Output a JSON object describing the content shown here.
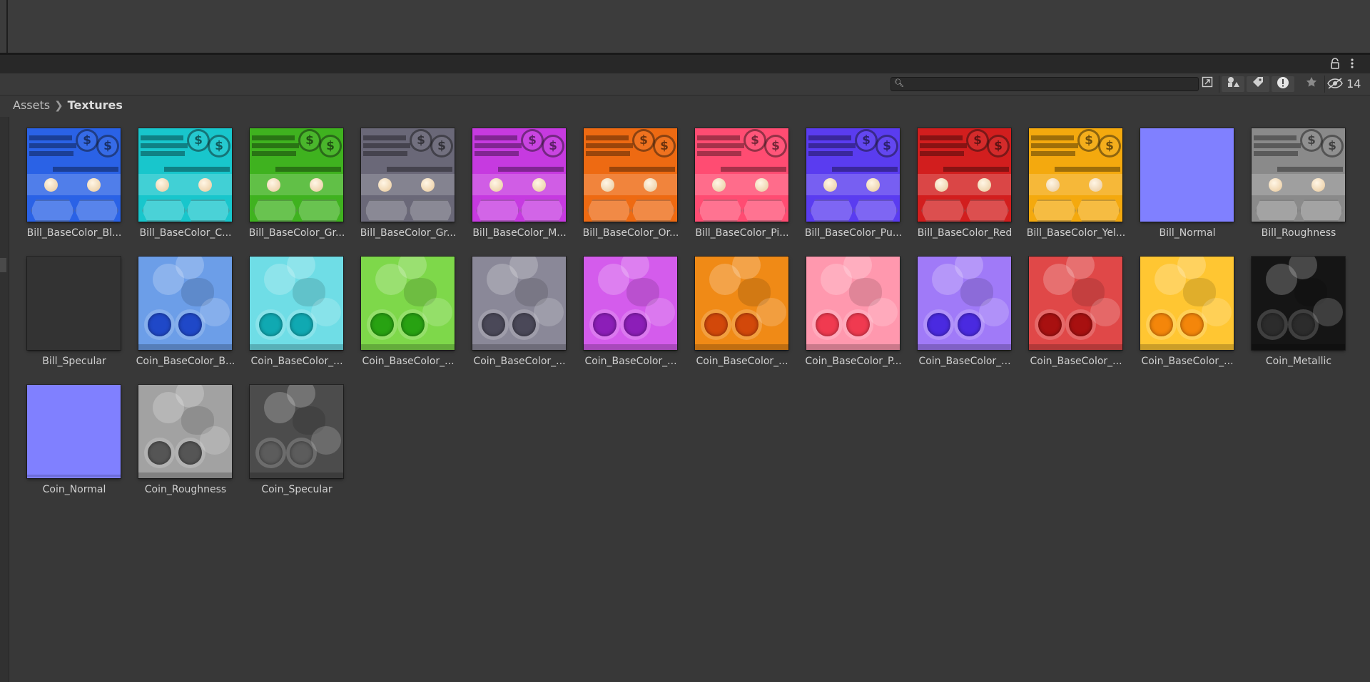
{
  "toolbar": {
    "search_placeholder": "",
    "hidden_count": "14",
    "icons": [
      "lock-icon",
      "kebab-menu-icon",
      "search-icon",
      "maximize-icon",
      "type-filter-icon",
      "label-filter-icon",
      "warning-filter-icon",
      "favorite-star-icon",
      "hidden-eye-icon"
    ]
  },
  "breadcrumb": {
    "root": "Assets",
    "current": "Textures"
  },
  "assets": [
    {
      "label": "Bill_BaseColor_Bl...",
      "kind": "bill",
      "color": "#2a62e6"
    },
    {
      "label": "Bill_BaseColor_C...",
      "kind": "bill",
      "color": "#18c6cc"
    },
    {
      "label": "Bill_BaseColor_Gr...",
      "kind": "bill",
      "color": "#3fb21f"
    },
    {
      "label": "Bill_BaseColor_Gr...",
      "kind": "bill",
      "color": "#6a6878"
    },
    {
      "label": "Bill_BaseColor_M...",
      "kind": "bill",
      "color": "#c63ae0"
    },
    {
      "label": "Bill_BaseColor_Or...",
      "kind": "bill",
      "color": "#ee6a12"
    },
    {
      "label": "Bill_BaseColor_Pi...",
      "kind": "bill",
      "color": "#ff4c72"
    },
    {
      "label": "Bill_BaseColor_Pu...",
      "kind": "bill",
      "color": "#5a3cf0"
    },
    {
      "label": "Bill_BaseColor_Red",
      "kind": "bill",
      "color": "#d21e1e"
    },
    {
      "label": "Bill_BaseColor_Yel...",
      "kind": "bill",
      "color": "#f4a90e"
    },
    {
      "label": "Bill_Normal",
      "kind": "flat",
      "color": "#8080ff"
    },
    {
      "label": "Bill_Roughness",
      "kind": "bill",
      "color": "#8a8a8a"
    },
    {
      "label": "Bill_Specular",
      "kind": "flat",
      "color": "#333333"
    },
    {
      "label": "Coin_BaseColor_B...",
      "kind": "coin",
      "color": "#6c9ee8",
      "disc": "#1f48c8"
    },
    {
      "label": "Coin_BaseColor_...",
      "kind": "coin",
      "color": "#6fdde6",
      "disc": "#10a9b2"
    },
    {
      "label": "Coin_BaseColor_...",
      "kind": "coin",
      "color": "#7ed84a",
      "disc": "#28a212"
    },
    {
      "label": "Coin_BaseColor_...",
      "kind": "coin",
      "color": "#8a8898",
      "disc": "#4a4858"
    },
    {
      "label": "Coin_BaseColor_...",
      "kind": "coin",
      "color": "#d45cec",
      "disc": "#8c1eb8"
    },
    {
      "label": "Coin_BaseColor_...",
      "kind": "coin",
      "color": "#f08a16",
      "disc": "#d2480a"
    },
    {
      "label": "Coin_BaseColor_P...",
      "kind": "coin",
      "color": "#ff98ae",
      "disc": "#f03a50"
    },
    {
      "label": "Coin_BaseColor_...",
      "kind": "coin",
      "color": "#a07af8",
      "disc": "#4a2ae0"
    },
    {
      "label": "Coin_BaseColor_...",
      "kind": "coin",
      "color": "#e04848",
      "disc": "#a81010"
    },
    {
      "label": "Coin_BaseColor_...",
      "kind": "coin",
      "color": "#ffc632",
      "disc": "#f4860a"
    },
    {
      "label": "Coin_Metallic",
      "kind": "coin",
      "color": "#151515",
      "disc": "#2c2c2c"
    },
    {
      "label": "Coin_Normal",
      "kind": "flat",
      "color": "#8080ff"
    },
    {
      "label": "Coin_Roughness",
      "kind": "coin",
      "color": "#a2a2a2",
      "disc": "#555555"
    },
    {
      "label": "Coin_Specular",
      "kind": "coin",
      "color": "#4c4c4c",
      "disc": "#5c5c5c"
    }
  ]
}
